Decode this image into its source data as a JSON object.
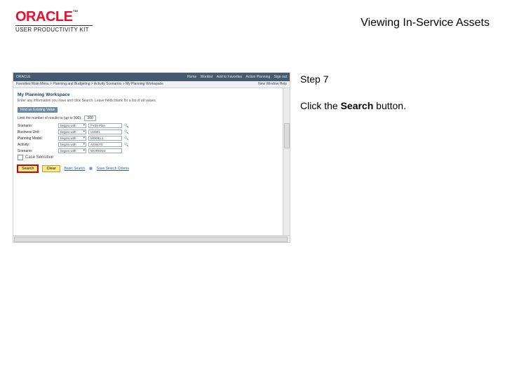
{
  "brand": {
    "logo": "ORACLE",
    "tm": "™",
    "subtitle": "USER PRODUCTIVITY KIT"
  },
  "page_title": "Viewing In-Service Assets",
  "instruction": {
    "step_label": "Step 7",
    "text_before": "Click the ",
    "target": "Search",
    "text_after": " button."
  },
  "shot": {
    "nav_left": {
      "oracle": "ORACLE",
      "crumbs": "Favorites    Main Menu  >  Planning and Budgeting  >  Activity Scenarios  >  My Planning Workspace"
    },
    "nav_right": [
      "Home",
      "Worklist",
      "Add to Favorites",
      "Action Planning",
      "Sign out"
    ],
    "toolbar_right": "New Window   Help",
    "title": "My Planning Workspace",
    "subtitle": "Enter any information you have and click Search. Leave fields blank for a list of all values.",
    "tab": "Find an Existing Value",
    "limit_label": "Limit the number of results to (up to 300):",
    "limit_value": "300",
    "fields": [
      {
        "label": "Scenario:",
        "op": "begins with",
        "val": "FY09 Plan"
      },
      {
        "label": "Business Unit:",
        "op": "begins with",
        "val": "US001"
      },
      {
        "label": "Planning Model:",
        "op": "begins with",
        "val": "MODEL1"
      },
      {
        "label": "Activity:",
        "op": "begins with",
        "val": "ASSETS"
      },
      {
        "label": "Scenario:",
        "op": "begins with",
        "val": "WORKING"
      }
    ],
    "case_label": "Case Sensitive",
    "search_btn": "Search",
    "clear_btn": "Clear",
    "basic_link": "Basic Search",
    "save_link": "Save Search Criteria"
  }
}
